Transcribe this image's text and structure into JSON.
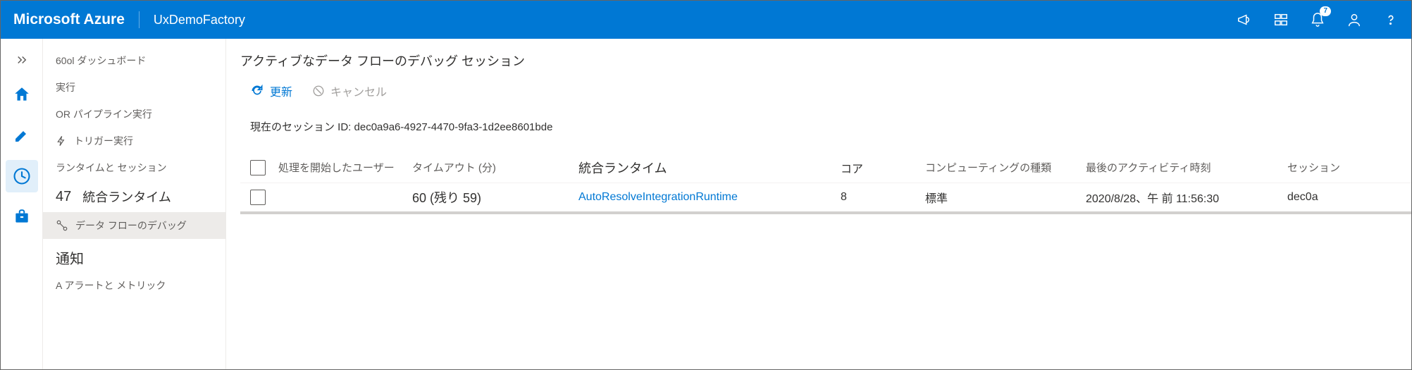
{
  "header": {
    "brand": "Microsoft Azure",
    "tenant": "UxDemoFactory",
    "notification_count": "7"
  },
  "sidebar": {
    "items": [
      {
        "label": "60ol ダッシュボード"
      },
      {
        "label": "実行"
      },
      {
        "label": "OR パイプライン実行"
      },
      {
        "label": "トリガー実行"
      },
      {
        "label": "ランタイムと セッション"
      },
      {
        "count": "47",
        "label": "統合ランタイム"
      },
      {
        "label": "データ フローのデバッグ"
      }
    ],
    "section_title": "通知",
    "alerts_label": "A アラートと メトリック"
  },
  "main": {
    "title": "アクティブなデータ フローのデバッグ セッション",
    "refresh_label": "更新",
    "cancel_label": "キャンセル",
    "session_id_label": "現在のセッション ID: dec0a9a6-4927-4470-9fa3-1d2ee8601bde",
    "columns": {
      "user": "処理を開始したユーザー",
      "timeout": "タイムアウト (分)",
      "runtime": "統合ランタイム",
      "core": "コア",
      "compute": "コンピューティングの種類",
      "activity": "最後のアクティビティ時刻",
      "session": "セッション"
    },
    "row": {
      "timeout": "60 (残り 59)",
      "runtime": "AutoResolveIntegrationRuntime",
      "core": "8",
      "compute": "標準",
      "activity": "2020/8/28、午 前 11:56:30",
      "session": "dec0a"
    }
  }
}
